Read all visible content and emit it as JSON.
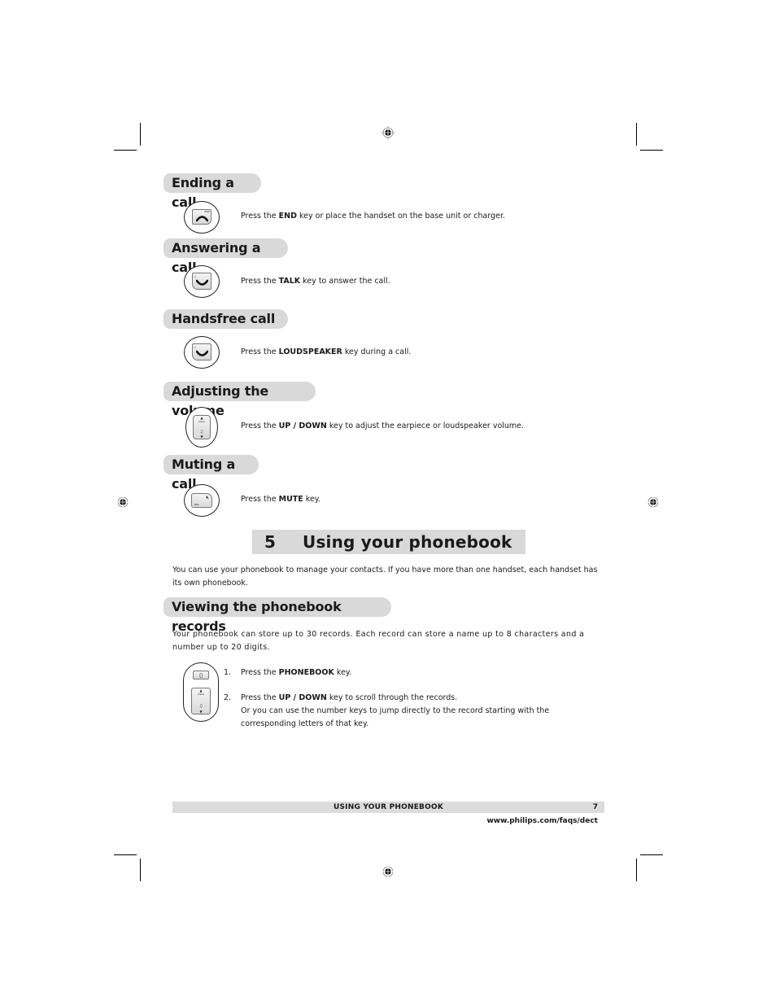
{
  "sections": [
    {
      "heading": "Ending a call",
      "icon": "end-key-icon",
      "text_before": "Press the ",
      "key": "END",
      "text_after": " key or place the handset on the base unit or charger."
    },
    {
      "heading": "Answering a call",
      "icon": "talk-key-icon",
      "text_before": "Press the ",
      "key": "TALK",
      "text_after": " key to answer the call."
    },
    {
      "heading": "Handsfree call",
      "icon": "loudspeaker-key-icon",
      "text_before": "Press the ",
      "key": "LOUDSPEAKER",
      "text_after": " key during a call."
    },
    {
      "heading": "Adjusting the volume",
      "icon": "up-down-key-icon",
      "text_before": "Press the ",
      "key": "UP / DOWN",
      "text_after": " key to adjust the earpiece or loudspeaker volume."
    },
    {
      "heading": "Muting a call",
      "icon": "mute-key-icon",
      "text_before": "Press the ",
      "key": "MUTE",
      "text_after": " key."
    }
  ],
  "chapter": {
    "number": "5",
    "title": "Using your phonebook"
  },
  "intro": "You can use your phonebook to manage your contacts.  If you have more than one handset, each handset has its own phonebook.",
  "viewing": {
    "heading": "Viewing the phonebook records",
    "description": "Your phonebook can store up to 30 records.  Each record can store a name up to 8 characters and a number up to 20 digits.",
    "steps": [
      {
        "num": "1.",
        "text_before": "Press the ",
        "key": "PHONEBOOK",
        "text_after": " key.",
        "extra": ""
      },
      {
        "num": "2.",
        "text_before": "Press the ",
        "key": "UP / DOWN",
        "text_after": " key to scroll through the records.",
        "extra": "Or you can use the number keys to jump directly to the record starting with the corresponding letters of that key."
      }
    ]
  },
  "key_labels": {
    "end": "END",
    "menu": "menu",
    "del": "DEL"
  },
  "footer": {
    "section_title": "USING YOUR PHONEBOOK",
    "page_number": "7",
    "url": "www.philips.com/faqs/dect"
  }
}
